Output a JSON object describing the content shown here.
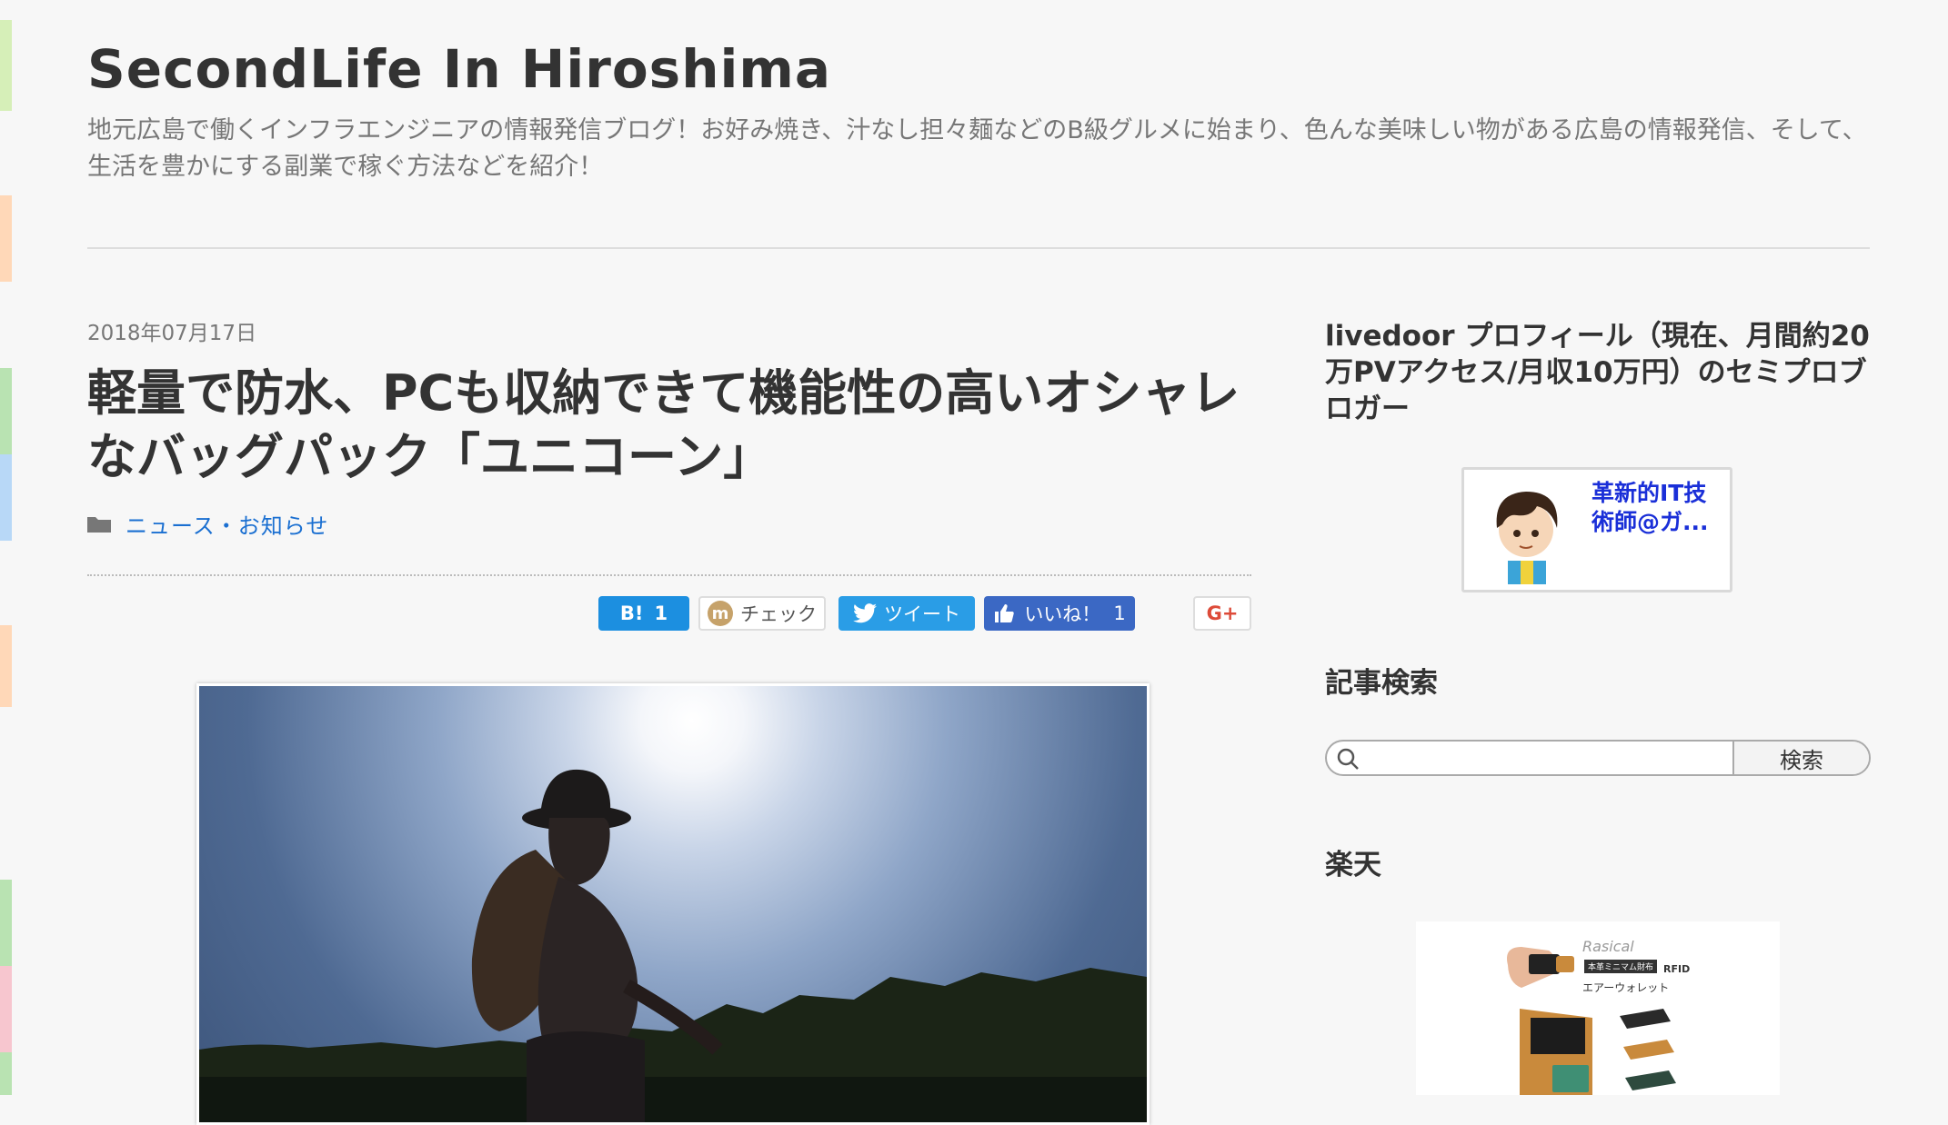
{
  "site": {
    "title": "SecondLife In Hiroshima",
    "description": "地元広島で働くインフラエンジニアの情報発信ブログ！お好み焼き、汁なし担々麺などのB級グルメに始まり、色んな美味しい物がある広島の情報発信、そして、生活を豊かにする副業で稼ぐ方法などを紹介！"
  },
  "post": {
    "date": "2018年07月17日",
    "title": "軽量で防水、PCも収納できて機能性の高いオシャレなバッグパック「ユニコーン」",
    "category": "ニュース・お知らせ"
  },
  "share": {
    "hatena_label": "B!",
    "hatena_count": "1",
    "mixi_label": "チェック",
    "mixi_icon": "m",
    "tweet_label": "ツイート",
    "like_label": "いいね！",
    "like_count": "1",
    "gplus_label": "G+"
  },
  "sidebar": {
    "profile_title": "livedoor プロフィール（現在、月間約20万PVアクセス/月収10万円）のセミプロブロガー",
    "profile_name": "革新的IT技術師@ガ...",
    "search_title": "記事検索",
    "search_button": "検索",
    "search_placeholder": "",
    "rakuten_title": "楽天",
    "ad": {
      "brand": "Rasical",
      "tag": "本革ミニマム財布",
      "rfid": "RFID",
      "product": "エアーウォレット"
    }
  },
  "colors": {
    "accent_link": "#1a6fd1",
    "hatena": "#1c8fe0",
    "twitter": "#2a9de6",
    "facebook": "#3b68c4",
    "gplus": "#dd4b39",
    "stripe": [
      "#d6efb8",
      "#ffd8b8",
      "#b9e3b2",
      "#b8d8f7",
      "#ffd8b8",
      "#b9e3b2",
      "#f7c6cf",
      "#b9e3b2"
    ]
  },
  "icons": [
    "folder-icon",
    "mixi-icon",
    "twitter-bird-icon",
    "thumbs-up-icon",
    "search-icon",
    "avatar"
  ]
}
